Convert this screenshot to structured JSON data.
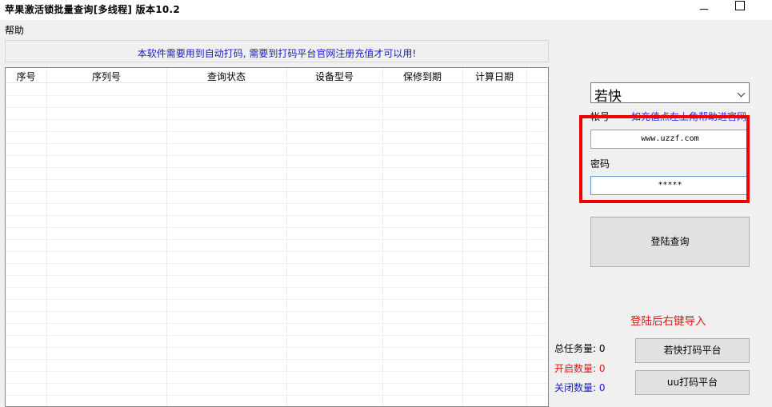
{
  "window": {
    "title": "苹果激活锁批量查询[多线程]  版本10.2"
  },
  "menu": {
    "items": [
      "帮助"
    ]
  },
  "notice": {
    "text": "本软件需要用到自动打码, 需要到打码平台官网注册充值才可以用!"
  },
  "grid": {
    "columns": [
      "序号",
      "序列号",
      "查询状态",
      "设备型号",
      "保修到期",
      "计算日期"
    ],
    "rows": []
  },
  "login": {
    "platform_select": "若快",
    "account_label": "帐号",
    "help_link": "如充值点左上角帮助进官网",
    "account_value": "www.uzzf.com",
    "password_label": "密码",
    "password_value": "*****",
    "login_button": "登陆查询",
    "hint": "登陆后右键导入"
  },
  "stats": {
    "total": "总任务量: 0",
    "open": "开启数量: 0",
    "closed": "关闭数量: 0"
  },
  "platform_buttons": {
    "ruokuai": "若快打码平台",
    "uu": "uu打码平台"
  },
  "colors": {
    "notice_text": "#1a1acc",
    "highlight_frame": "#ee0000",
    "hint_text": "#e01818",
    "open_count": "#e01818",
    "closed_count": "#1a1acc",
    "link": "#2a2aee"
  }
}
